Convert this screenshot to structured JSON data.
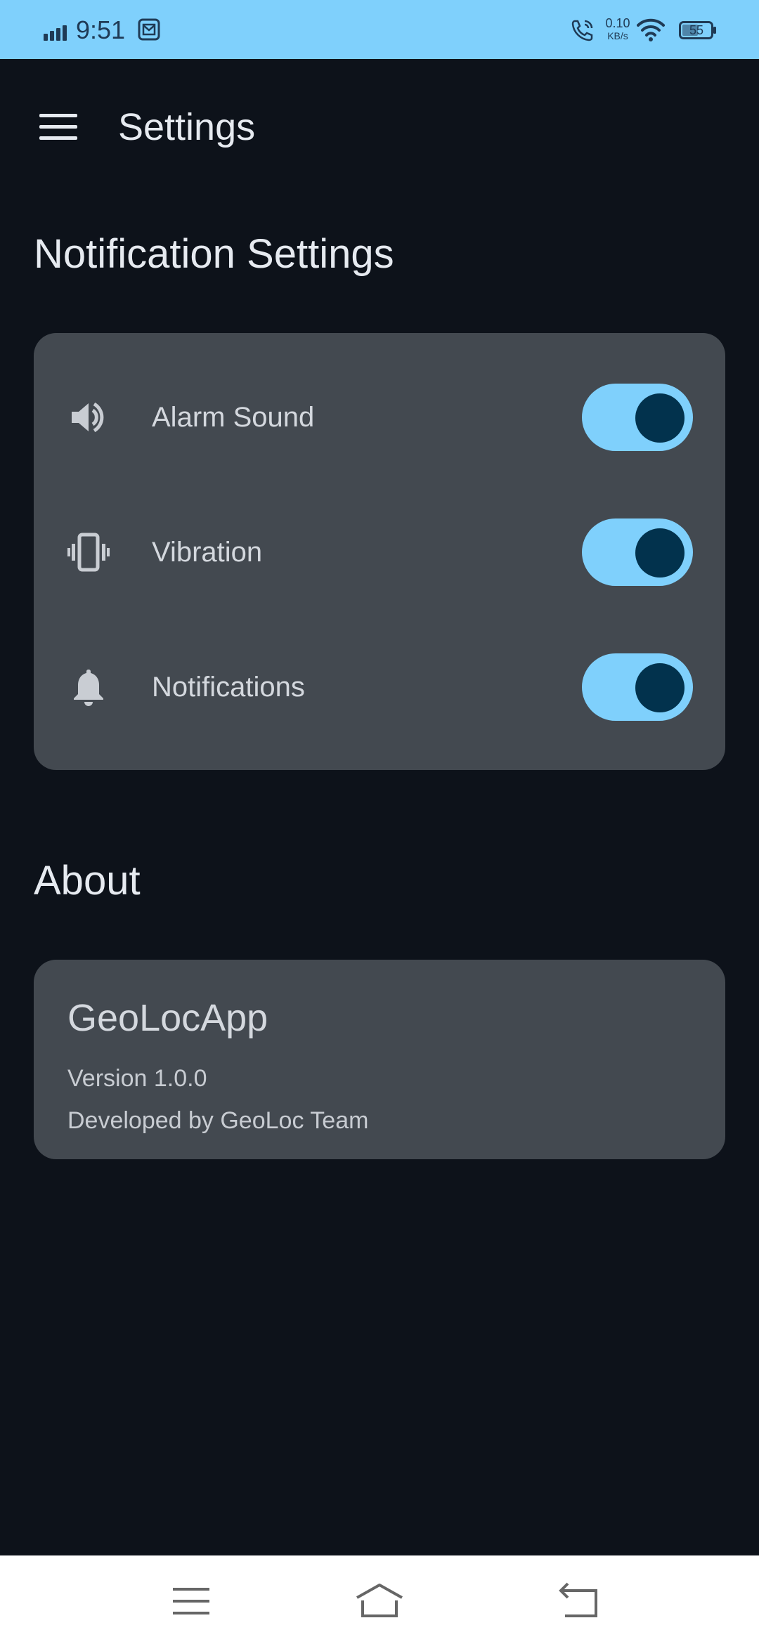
{
  "status_bar": {
    "time": "9:51",
    "net_speed_value": "0.10",
    "net_speed_unit": "KB/s",
    "battery": "55",
    "icons": [
      "signal-icon",
      "mail-icon",
      "wifi-call-icon",
      "wifi-icon",
      "battery-icon"
    ]
  },
  "app_bar": {
    "title": "Settings",
    "menu_icon": "hamburger-menu-icon"
  },
  "notification_section": {
    "title": "Notification Settings",
    "items": [
      {
        "label": "Alarm Sound",
        "icon": "speaker-icon",
        "enabled": true
      },
      {
        "label": "Vibration",
        "icon": "vibration-icon",
        "enabled": true
      },
      {
        "label": "Notifications",
        "icon": "bell-icon",
        "enabled": true
      }
    ]
  },
  "about_section": {
    "title": "About",
    "app_name": "GeoLocApp",
    "version": "Version 1.0.0",
    "developer": "Developed by GeoLoc Team"
  },
  "nav_bar": {
    "icons": [
      "recent-apps-icon",
      "home-icon",
      "back-icon"
    ]
  },
  "colors": {
    "status_bar_bg": "#7fd0fc",
    "background": "#0d121a",
    "card_bg": "#434950",
    "switch_track": "#7fd0fc",
    "switch_knob": "#02324d"
  }
}
